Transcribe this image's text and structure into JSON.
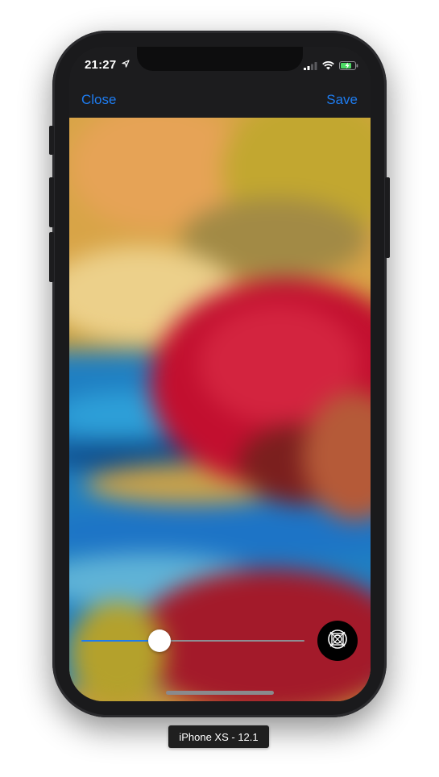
{
  "status_bar": {
    "time": "21:27",
    "location_icon": "location-arrow-icon",
    "signal_icon": "cellular-signal-icon",
    "wifi_icon": "wifi-icon",
    "battery_icon": "battery-charging-icon",
    "battery_color": "#4cd964"
  },
  "navbar": {
    "close_label": "Close",
    "save_label": "Save",
    "accent_color": "#1e7cf0"
  },
  "image": {
    "subject_icon": "blurred-water-lily-photo"
  },
  "blur_slider": {
    "value": 0.35
  },
  "action_button": {
    "icon": "aperture-lens-icon"
  },
  "device_label": "iPhone XS - 12.1"
}
